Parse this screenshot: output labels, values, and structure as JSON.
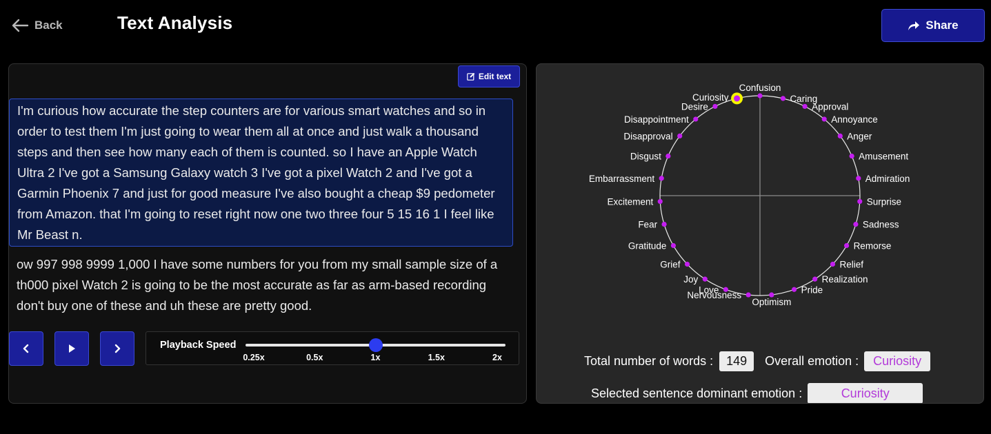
{
  "header": {
    "back_label": "Back",
    "title": "Text Analysis",
    "share_label": "Share"
  },
  "editor": {
    "edit_label": "Edit text",
    "active_paragraph": "I'm curious how accurate the step counters are for various smart watches and so in order to test them I'm just going to wear them all at once and just walk a thousand steps and then see how many each of them is counted. so I have an Apple Watch Ultra 2 I've got a Samsung Galaxy watch 3 I've got a pixel Watch 2 and I've got a Garmin Phoenix 7 and just for good measure I've also bought a cheap $9 pedometer from Amazon. that I'm going to reset right now one two three four 5 15 16 1 I feel like Mr Beast n.",
    "rest_paragraph": "ow 997 998 9999 1,000 I have some numbers for you from my small sample size of a th000 pixel Watch 2 is going to be the most accurate as far as arm-based recording don't buy one of these and uh these are pretty good."
  },
  "playback": {
    "label": "Playback Speed",
    "options": [
      "0.25x",
      "0.5x",
      "1x",
      "1.5x",
      "2x"
    ],
    "selected_index": 2
  },
  "wheel": {
    "emotions": [
      "Confusion",
      "Caring",
      "Approval",
      "Annoyance",
      "Anger",
      "Amusement",
      "Admiration",
      "Surprise",
      "Sadness",
      "Remorse",
      "Relief",
      "Realization",
      "Pride",
      "Optimism",
      "Nervousness",
      "Love",
      "Joy",
      "Grief",
      "Gratitude",
      "Fear",
      "Excitement",
      "Embarrassment",
      "Disgust",
      "Disapproval",
      "Disappointment",
      "Desire",
      "Curiosity"
    ],
    "selected": "Curiosity",
    "dot_color": "#c41ef0",
    "highlight_color": "#f5f500"
  },
  "stats": {
    "total_words_label": "Total number of words :",
    "total_words": "149",
    "overall_label": "Overall emotion :",
    "overall_emotion": "Curiosity",
    "sentence_label": "Selected sentence dominant emotion :",
    "sentence_emotion": "Curiosity"
  }
}
